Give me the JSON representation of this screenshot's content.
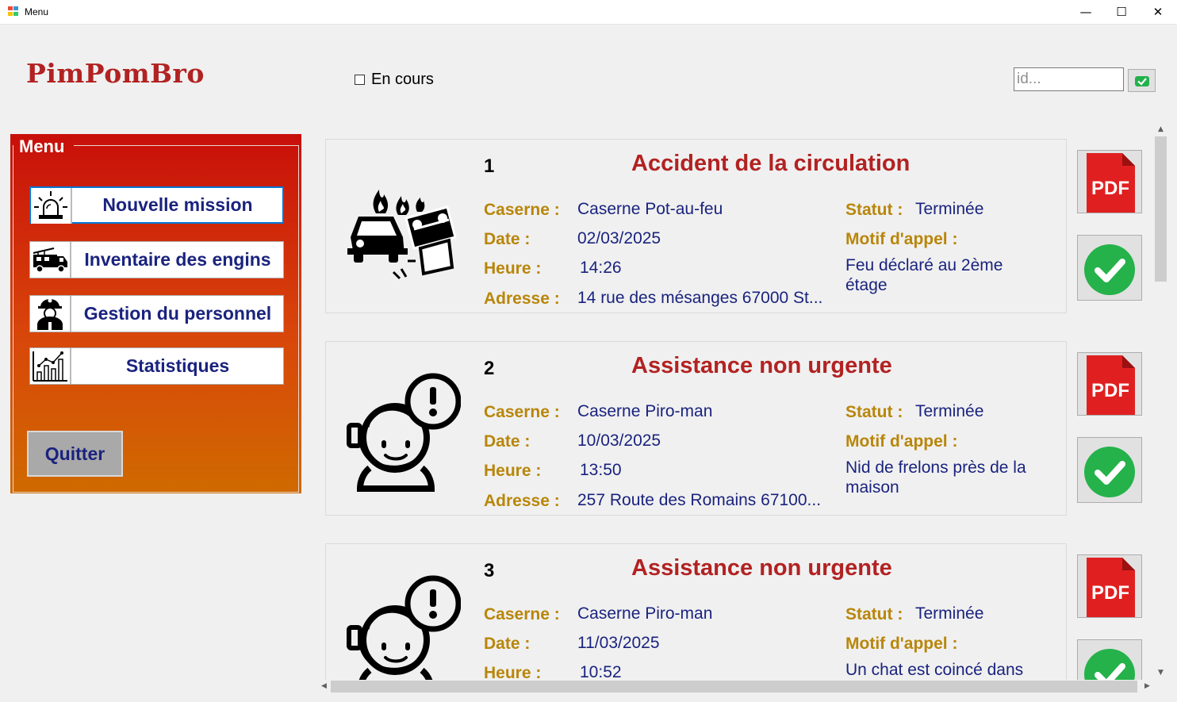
{
  "window": {
    "title": "Menu",
    "minimize": "—",
    "maximize": "☐",
    "close": "✕"
  },
  "header": {
    "logo": "PimPomBro",
    "filter_label": "En cours",
    "id_placeholder": "id..."
  },
  "menu": {
    "legend": "Menu",
    "items": [
      {
        "label": "Nouvelle mission",
        "icon": "siren-icon"
      },
      {
        "label": "Inventaire des engins",
        "icon": "fire-truck-icon"
      },
      {
        "label": "Gestion du personnel",
        "icon": "firefighter-icon"
      },
      {
        "label": "Statistiques",
        "icon": "chart-icon"
      }
    ],
    "quit_label": "Quitter"
  },
  "labels": {
    "caserne": "Caserne :",
    "date": "Date :",
    "heure": "Heure :",
    "adresse": "Adresse :",
    "statut": "Statut :",
    "motif": "Motif d'appel :",
    "pdf": "PDF"
  },
  "missions": [
    {
      "id": "1",
      "title": "Accident de la circulation",
      "icon": "car-crash-fire-icon",
      "caserne": "Caserne Pot-au-feu",
      "date": "02/03/2025",
      "heure": "14:26",
      "adresse": "14 rue des mésanges 67000 St...",
      "statut": "Terminée",
      "motif": "Feu déclaré au 2ème étage"
    },
    {
      "id": "2",
      "title": "Assistance non urgente",
      "icon": "operator-alert-icon",
      "caserne": "Caserne Piro-man",
      "date": "10/03/2025",
      "heure": "13:50",
      "adresse": "257 Route des Romains 67100...",
      "statut": "Terminée",
      "motif": "Nid de frelons près de la maison"
    },
    {
      "id": "3",
      "title": "Assistance non urgente",
      "icon": "operator-alert-icon",
      "caserne": "Caserne Piro-man",
      "date": "11/03/2025",
      "heure": "10:52",
      "adresse": "",
      "statut": "Terminée",
      "motif": "Un chat est coincé dans"
    }
  ],
  "colors": {
    "title_red": "#b22222",
    "label_gold": "#b8860b",
    "value_navy": "#1a237e",
    "panel_top": "#c80f0a",
    "panel_bottom": "#d06a00"
  }
}
